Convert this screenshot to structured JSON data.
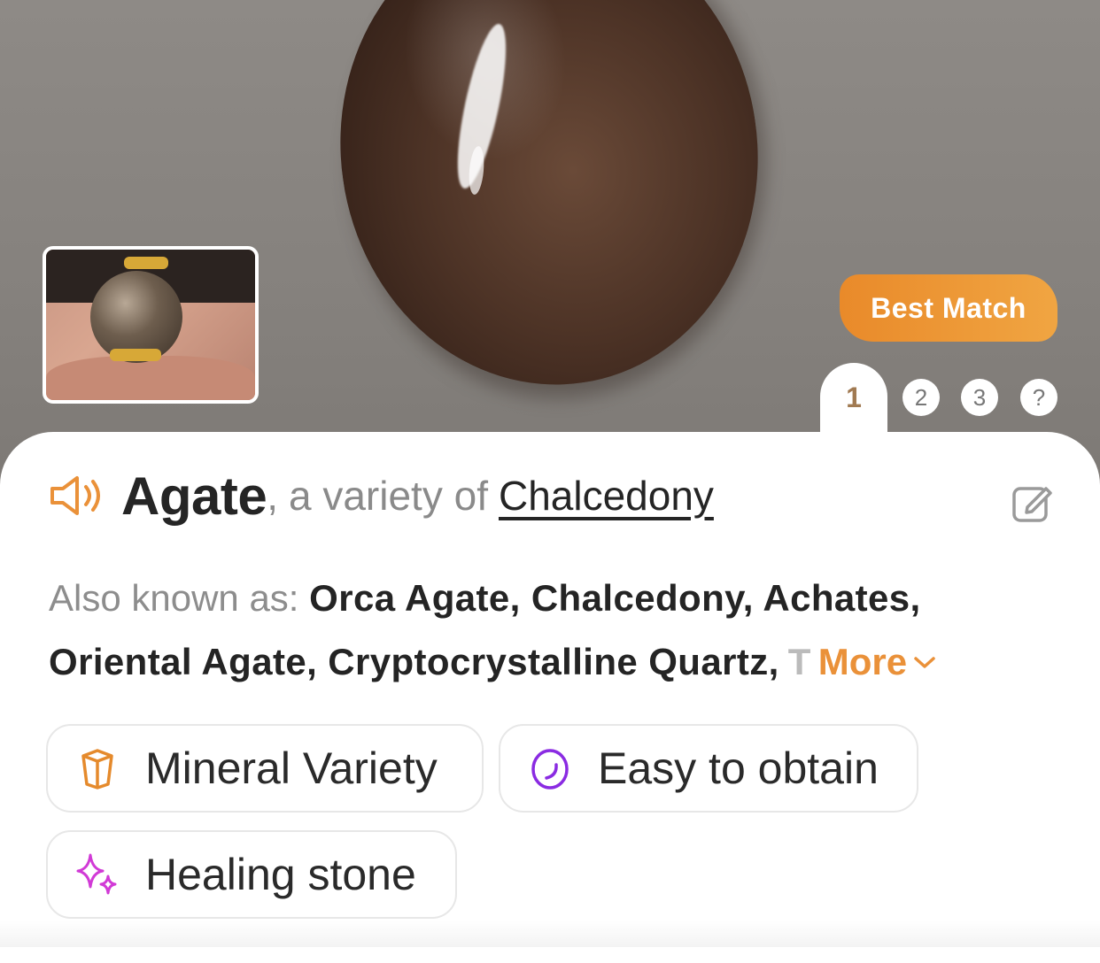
{
  "hero": {
    "badge": "Best Match",
    "tabs": [
      "1",
      "2",
      "3",
      "?"
    ],
    "active_tab": "1"
  },
  "header": {
    "name": "Agate",
    "separator": ",",
    "variety_prefix": "a variety of",
    "parent": "Chalcedony"
  },
  "aka": {
    "label": "Also known as:",
    "line1": "Orca Agate, Chalcedony, Achates,",
    "line2": "Oriental Agate, Cryptocrystalline Quartz,",
    "truncated": "T",
    "more_label": "More"
  },
  "chips": [
    {
      "label": "Mineral Variety",
      "icon": "crystal-icon",
      "color": "#e58a2c"
    },
    {
      "label": "Easy to obtain",
      "icon": "stone-icon",
      "color": "#8a2be2"
    },
    {
      "label": "Healing stone",
      "icon": "sparkle-icon",
      "color": "#d13ad6"
    }
  ],
  "colors": {
    "accent": "#ea9139",
    "badge_from": "#e98a2a",
    "badge_to": "#f0a542",
    "text": "#252525",
    "muted": "#8a8a8a"
  }
}
